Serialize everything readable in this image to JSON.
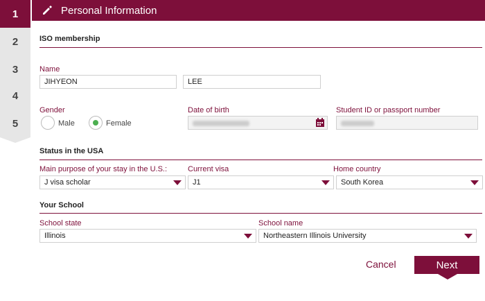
{
  "steps": [
    "1",
    "2",
    "3",
    "4",
    "5"
  ],
  "header": {
    "title": "Personal Information"
  },
  "sections": {
    "iso": "ISO membership",
    "status": "Status in the USA",
    "school": "Your School"
  },
  "name": {
    "label": "Name",
    "first": "JIHYEON",
    "last": "LEE"
  },
  "gender": {
    "label": "Gender",
    "options": [
      "Male",
      "Female"
    ],
    "selected": "Female"
  },
  "dob": {
    "label": "Date of birth",
    "value_hidden": true
  },
  "student_id": {
    "label": "Student ID or passport number",
    "value_hidden": true
  },
  "purpose": {
    "label": "Main purpose of your stay in the U.S.:",
    "value": "J visa scholar"
  },
  "visa": {
    "label": "Current visa",
    "value": "J1"
  },
  "country": {
    "label": "Home country",
    "value": "South Korea"
  },
  "school_state": {
    "label": "School state",
    "value": "Illinois"
  },
  "school_name": {
    "label": "School name",
    "value": "Northeastern Illinois University"
  },
  "actions": {
    "cancel": "Cancel",
    "next": "Next"
  },
  "colors": {
    "accent": "#7d0f3a",
    "radio_checked": "#4caf50"
  }
}
